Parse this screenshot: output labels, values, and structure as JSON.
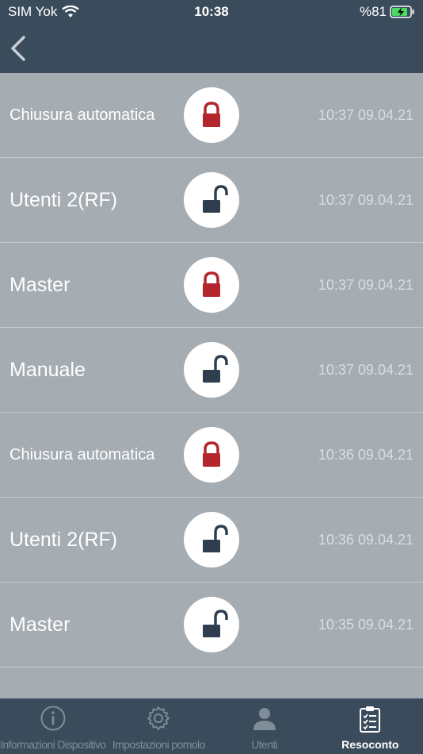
{
  "status_bar": {
    "carrier": "SIM Yok",
    "time": "10:38",
    "battery_text": "%81"
  },
  "colors": {
    "header": "#3a4b5c",
    "list_bg": "#a5acb2",
    "locked": "#b3262c",
    "unlocked": "#2e3e4e",
    "tab_inactive": "#7f8d99",
    "tab_active": "#ffffff"
  },
  "log": [
    {
      "name": "Chiusura automatica",
      "state": "locked",
      "timestamp": "10:37 09.04.21"
    },
    {
      "name": "Utenti 2(RF)",
      "state": "unlocked",
      "timestamp": "10:37 09.04.21"
    },
    {
      "name": "Master",
      "state": "locked",
      "timestamp": "10:37 09.04.21"
    },
    {
      "name": "Manuale",
      "state": "unlocked",
      "timestamp": "10:37 09.04.21"
    },
    {
      "name": "Chiusura automatica",
      "state": "locked",
      "timestamp": "10:36 09.04.21"
    },
    {
      "name": "Utenti 2(RF)",
      "state": "unlocked",
      "timestamp": "10:36 09.04.21"
    },
    {
      "name": "Master",
      "state": "unlocked",
      "timestamp": "10:35 09.04.21"
    }
  ],
  "tabs": [
    {
      "label": "Informazioni Dispositivo",
      "icon": "info-icon",
      "active": false
    },
    {
      "label": "Impostazioni pomolo",
      "icon": "gear-icon",
      "active": false
    },
    {
      "label": "Utenti",
      "icon": "user-icon",
      "active": false
    },
    {
      "label": "Resoconto",
      "icon": "clipboard-checklist-icon",
      "active": true
    }
  ]
}
